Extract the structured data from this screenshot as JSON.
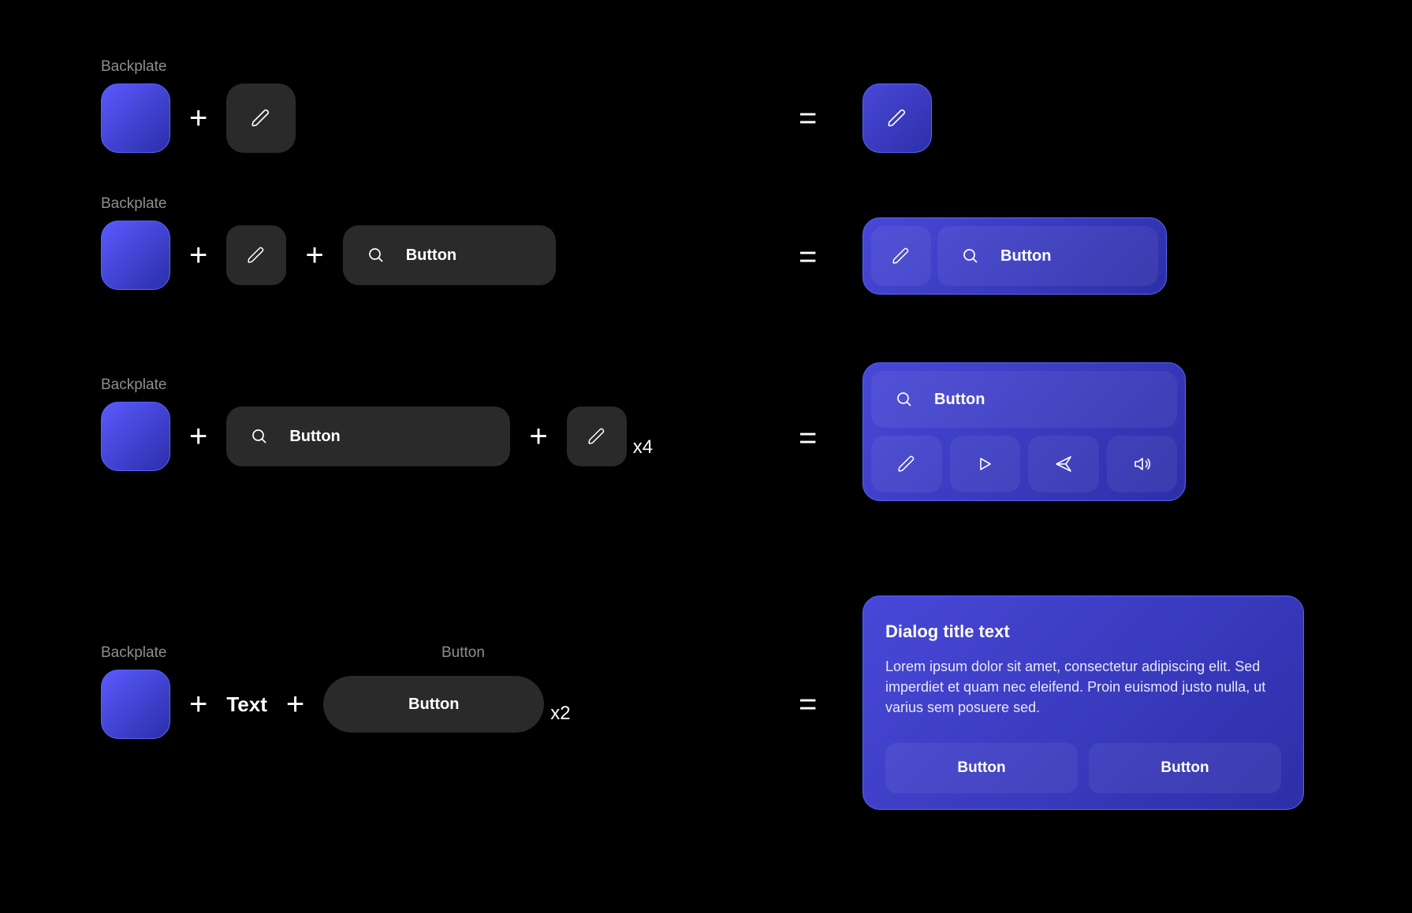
{
  "label_backplate": "Backplate",
  "label_button_small": "Button",
  "text_chip": "Text",
  "op_plus": "+",
  "op_eq": "=",
  "mult_x4": "x4",
  "mult_x2": "x2",
  "row1": {
    "ghost_icon": "pencil",
    "result_icon": "pencil"
  },
  "row2": {
    "ghost1_icon": "pencil",
    "ghost2_icon": "search",
    "ghost2_label": "Button",
    "result": {
      "icon1": "pencil",
      "icon2": "search",
      "label2": "Button"
    }
  },
  "row3": {
    "ghost1_icon": "search",
    "ghost1_label": "Button",
    "ghost2_icon": "pencil",
    "result": {
      "top_icon": "search",
      "top_label": "Button",
      "icons": [
        "pencil",
        "play",
        "send",
        "speaker"
      ]
    }
  },
  "row4": {
    "ghost_button_label": "Button",
    "dialog": {
      "title": "Dialog title text",
      "body": "Lorem ipsum dolor sit amet, consectetur adipiscing elit. Sed imperdiet et quam nec eleifend. Proin euismod justo nulla, ut varius sem posuere sed.",
      "btn1": "Button",
      "btn2": "Button"
    }
  }
}
